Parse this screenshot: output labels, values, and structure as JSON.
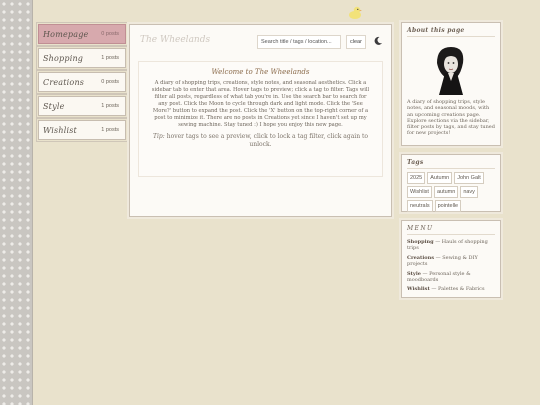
{
  "sidebar": {
    "items": [
      {
        "label": "Homepage",
        "count": "0 posts",
        "active": true
      },
      {
        "label": "Shopping",
        "count": "1 posts"
      },
      {
        "label": "Creations",
        "count": "0 posts"
      },
      {
        "label": "Style",
        "count": "1 posts"
      },
      {
        "label": "Wishlist",
        "count": "1 posts"
      }
    ]
  },
  "main": {
    "title": "The Wheelands",
    "search_placeholder": "Search title / tags / location...",
    "clear_label": "clear",
    "welcome_title": "Welcome to The Wheelands",
    "welcome_body": "A diary of shopping trips, creations, style notes, and seasonal aesthetics. Click a sidebar tab to enter that area. Hover tags to preview; click a tag to filter. Tags will filter all posts, regardless of what tab you're in. Use the search bar to search for any post. Click the Moon to cycle through dark and light mode. Click the 'See More?' button to expand the post. Click the 'X' button on the top-right corner of a post to minimize it. There are no posts in Creations yet since I haven't set up my sewing machine. Stay tuned :) I hope you enjoy this new page.",
    "tip_label": "Tip:",
    "tip_text": "hover tags to see a preview, click to lock a tag filter, click again to unlock."
  },
  "about": {
    "title": "About this page",
    "text": "A diary of shopping trips, style notes, and seasonal moods, with an upcoming creations page. Explore sections via the sidebar, filter posts by tags, and stay tuned for new projects!"
  },
  "tags": {
    "title": "Tags",
    "items": [
      "2025",
      "Autumn",
      "John Galt",
      "Wishlist",
      "autumn",
      "navy",
      "neutrals",
      "pointelle"
    ]
  },
  "menu": {
    "title": "MENU",
    "items": [
      {
        "name": "Shopping",
        "desc": "— Hauls of shopping trips"
      },
      {
        "name": "Creations",
        "desc": "— Sewing & DIY projects"
      },
      {
        "name": "Style",
        "desc": "— Personal style & moodboards"
      },
      {
        "name": "Wishlist",
        "desc": "— Palettes & Fabrics"
      }
    ]
  },
  "colors": {
    "background": "#e9e2cc",
    "active_tab": "#d7a9ad",
    "panel": "#fcfaf6"
  },
  "icons": [
    "duck-icon",
    "moon-icon",
    "portrait-image"
  ]
}
